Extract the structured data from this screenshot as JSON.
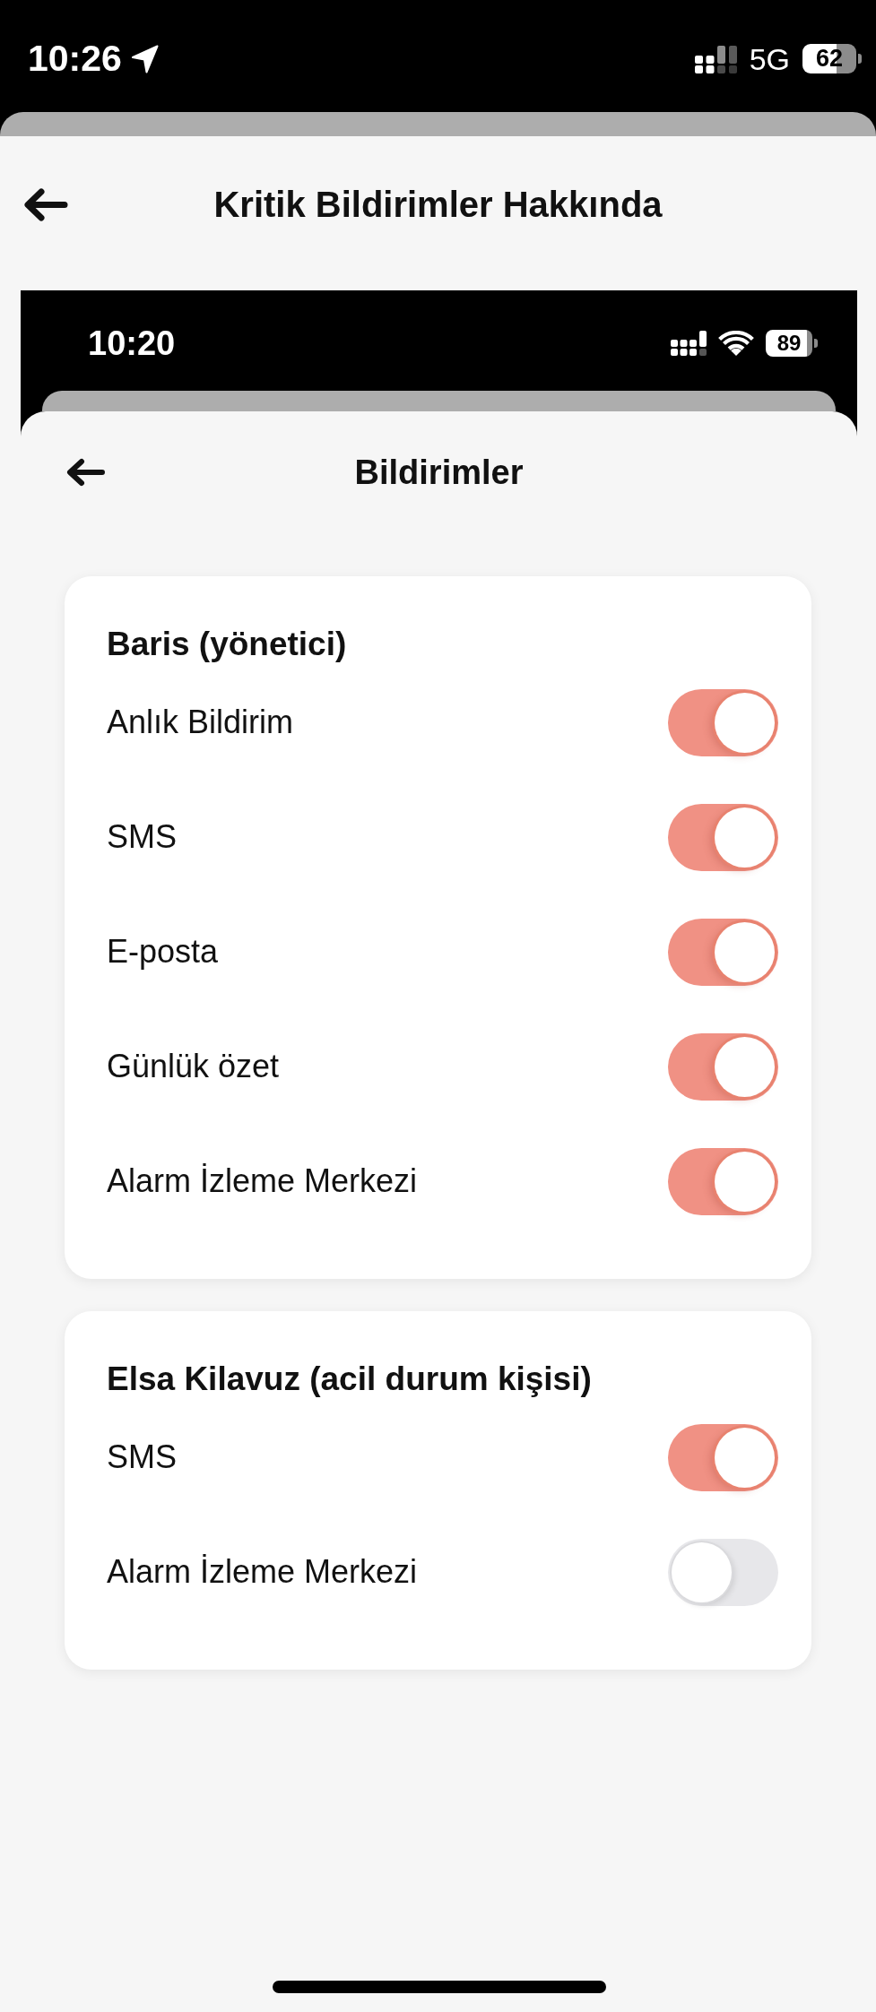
{
  "status_bar": {
    "time": "10:26",
    "network": "5G",
    "battery": "62"
  },
  "header": {
    "title": "Kritik Bildirimler Hakkında"
  },
  "embedded_screenshot": {
    "status_bar": {
      "time": "10:20",
      "battery": "89"
    },
    "header": {
      "title": "Bildirimler"
    },
    "sections": [
      {
        "title": "Baris (yönetici)",
        "settings": [
          {
            "label": "Anlık Bildirim",
            "on": true
          },
          {
            "label": "SMS",
            "on": true
          },
          {
            "label": "E-posta",
            "on": true
          },
          {
            "label": "Günlük özet",
            "on": true
          },
          {
            "label": "Alarm İzleme Merkezi",
            "on": true
          }
        ]
      },
      {
        "title": "Elsa Kilavuz (acil durum kişisi)",
        "settings": [
          {
            "label": "SMS",
            "on": true
          },
          {
            "label": "Alarm İzleme Merkezi",
            "on": false
          }
        ]
      }
    ]
  }
}
